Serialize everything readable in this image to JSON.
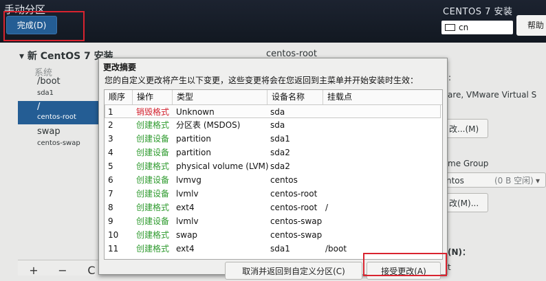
{
  "header": {
    "page_title": "手动分区",
    "done_button": "完成(D)",
    "product_title": "CENTOS 7 安装",
    "keyboard_layout": "cn",
    "help_button": "帮助"
  },
  "sidebar": {
    "group_title": "▾ 新 CentOS 7 安装",
    "group_subtitle": "系统",
    "partitions": [
      {
        "mount": "/boot",
        "device": "sda1",
        "selected": false
      },
      {
        "mount": "/",
        "device": "centos-root",
        "selected": true
      },
      {
        "mount": "swap",
        "device": "centos-swap",
        "selected": false
      }
    ],
    "toolbar": {
      "add": "+",
      "remove": "−",
      "refresh": "C"
    }
  },
  "detail_panel": {
    "title": "centos-root",
    "colon_label": ":",
    "device_desc": "are, VMware Virtual S",
    "modify_button_1": "改...(M)",
    "volume_group_label": "me Group",
    "volume_group_value": "ntos",
    "volume_group_free": "(0 B 空闲)",
    "modify_button_2": "改(M)...",
    "name_label": "(N)：",
    "name_colon": "t"
  },
  "dialog": {
    "title": "更改摘要",
    "description": "您的自定义更改将产生以下变更，这些变更将会在您返回到主菜单并开始安装时生效：",
    "columns": [
      "顺序",
      "操作",
      "类型",
      "设备名称",
      "挂载点"
    ],
    "rows": [
      {
        "order": "1",
        "action": "销毁格式",
        "kind": "delete",
        "type": "Unknown",
        "device": "sda",
        "mount": ""
      },
      {
        "order": "2",
        "action": "创建格式",
        "kind": "create",
        "type": "分区表 (MSDOS)",
        "device": "sda",
        "mount": ""
      },
      {
        "order": "3",
        "action": "创建设备",
        "kind": "create",
        "type": "partition",
        "device": "sda1",
        "mount": ""
      },
      {
        "order": "4",
        "action": "创建设备",
        "kind": "create",
        "type": "partition",
        "device": "sda2",
        "mount": ""
      },
      {
        "order": "5",
        "action": "创建格式",
        "kind": "create",
        "type": "physical volume (LVM)",
        "device": "sda2",
        "mount": ""
      },
      {
        "order": "6",
        "action": "创建设备",
        "kind": "create",
        "type": "lvmvg",
        "device": "centos",
        "mount": ""
      },
      {
        "order": "7",
        "action": "创建设备",
        "kind": "create",
        "type": "lvmlv",
        "device": "centos-root",
        "mount": ""
      },
      {
        "order": "8",
        "action": "创建格式",
        "kind": "create",
        "type": "ext4",
        "device": "centos-root",
        "mount": "/"
      },
      {
        "order": "9",
        "action": "创建设备",
        "kind": "create",
        "type": "lvmlv",
        "device": "centos-swap",
        "mount": ""
      },
      {
        "order": "10",
        "action": "创建格式",
        "kind": "create",
        "type": "swap",
        "device": "centos-swap",
        "mount": ""
      },
      {
        "order": "11",
        "action": "创建格式",
        "kind": "create",
        "type": "ext4",
        "device": "sda1",
        "mount": "/boot"
      }
    ],
    "cancel_button": "取消并返回到自定义分区(C)",
    "accept_button": "接受更改(A)"
  },
  "colors": {
    "header_bg": "#161c27",
    "selected_bg": "#245d94",
    "delete_action": "#d21f2c",
    "create_action": "#2f9b2f",
    "highlight_box": "#d9232f"
  }
}
